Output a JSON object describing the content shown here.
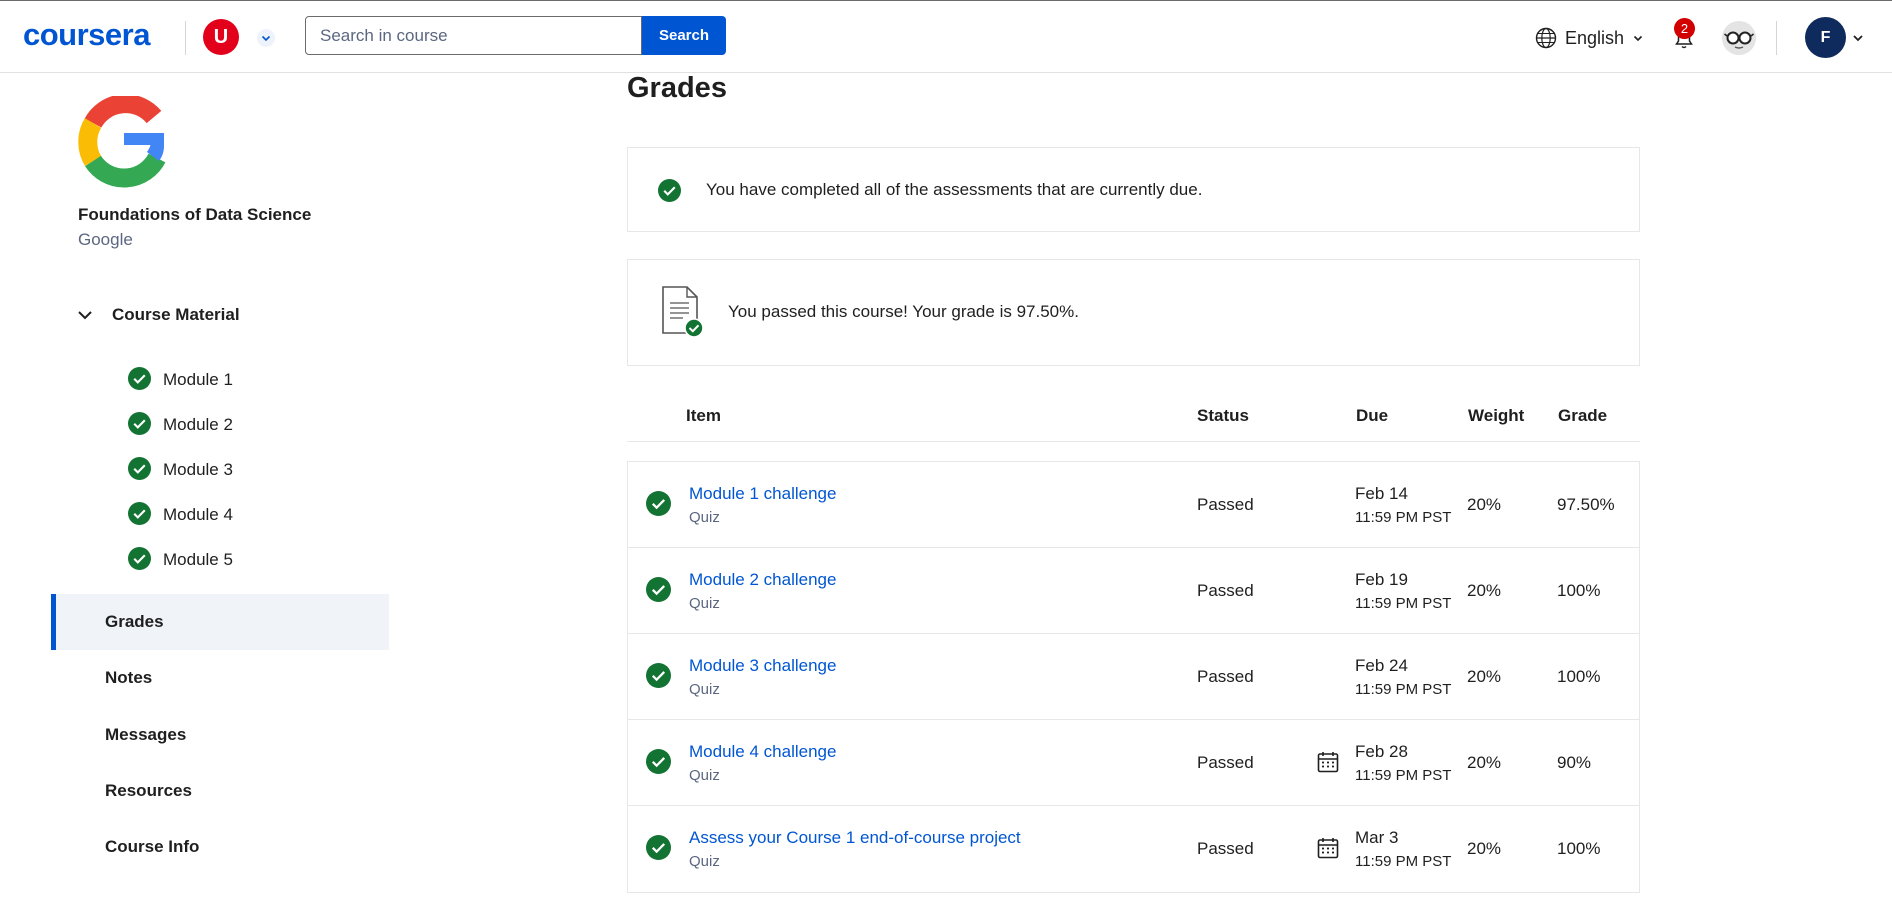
{
  "header": {
    "logo_text": "coursera",
    "partner_initial": "U",
    "search": {
      "placeholder": "Search in course",
      "button_label": "Search"
    },
    "language": "English",
    "notification_count": "2",
    "user_initial": "F"
  },
  "sidebar": {
    "course_title": "Foundations of Data Science",
    "course_partner": "Google",
    "section_label": "Course Material",
    "modules": [
      "Module 1",
      "Module 2",
      "Module 3",
      "Module 4",
      "Module 5"
    ],
    "nav": [
      {
        "label": "Grades",
        "active": true
      },
      {
        "label": "Notes",
        "active": false
      },
      {
        "label": "Messages",
        "active": false
      },
      {
        "label": "Resources",
        "active": false
      },
      {
        "label": "Course Info",
        "active": false
      }
    ]
  },
  "main": {
    "title": "Grades",
    "due_message": "You have completed all of the assessments that are currently due.",
    "pass_message": "You passed this course! Your grade is 97.50%.",
    "table_headers": {
      "item": "Item",
      "status": "Status",
      "due": "Due",
      "weight": "Weight",
      "grade": "Grade"
    },
    "rows": [
      {
        "item": "Module 1 challenge",
        "type": "Quiz",
        "status": "Passed",
        "due_date": "Feb 14",
        "due_time": "11:59 PM PST",
        "weight": "20%",
        "grade": "97.50%",
        "calendar_icon": false
      },
      {
        "item": "Module 2 challenge",
        "type": "Quiz",
        "status": "Passed",
        "due_date": "Feb 19",
        "due_time": "11:59 PM PST",
        "weight": "20%",
        "grade": "100%",
        "calendar_icon": false
      },
      {
        "item": "Module 3 challenge",
        "type": "Quiz",
        "status": "Passed",
        "due_date": "Feb 24",
        "due_time": "11:59 PM PST",
        "weight": "20%",
        "grade": "100%",
        "calendar_icon": false
      },
      {
        "item": "Module 4 challenge",
        "type": "Quiz",
        "status": "Passed",
        "due_date": "Feb 28",
        "due_time": "11:59 PM PST",
        "weight": "20%",
        "grade": "90%",
        "calendar_icon": true
      },
      {
        "item": "Assess your Course 1 end-of-course project",
        "type": "Quiz",
        "status": "Passed",
        "due_date": "Mar 3",
        "due_time": "11:59 PM PST",
        "weight": "20%",
        "grade": "100%",
        "calendar_icon": true
      }
    ]
  },
  "colors": {
    "brand": "#0056d2",
    "success": "#137333",
    "partner": "#e3001b",
    "notification": "#d30001",
    "user_avatar": "#0f2a5c"
  }
}
